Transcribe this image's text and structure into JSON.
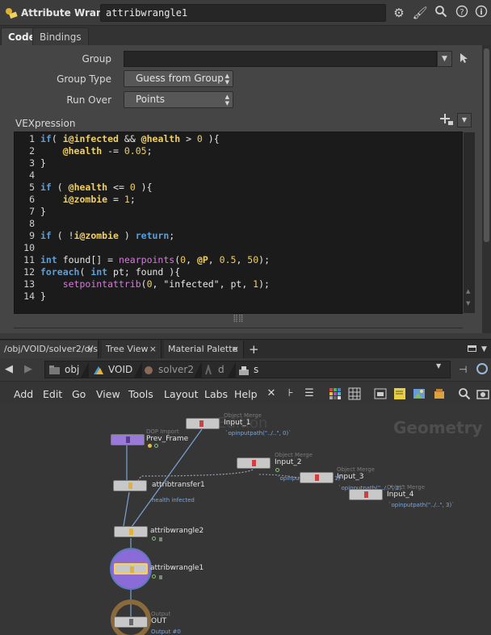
{
  "header": {
    "node_type": "Attribute Wrangle",
    "node_name": "attribwrangle1",
    "icons": [
      "gear-icon",
      "paint-brush-icon",
      "search-icon",
      "help-icon",
      "info-icon"
    ]
  },
  "tabs": [
    {
      "label": "Code",
      "active": true
    },
    {
      "label": "Bindings",
      "active": false
    }
  ],
  "params": {
    "group_label": "Group",
    "group_value": "",
    "group_type_label": "Group Type",
    "group_type_value": "Guess from Group",
    "run_over_label": "Run Over",
    "run_over_value": "Points",
    "vexpression_label": "VEXpression"
  },
  "code": {
    "line_numbers": [
      "1",
      "2",
      "3",
      "4",
      "5",
      "6",
      "7",
      "8",
      "9",
      "10",
      "11",
      "12",
      "13",
      "14"
    ],
    "lines": [
      "if( i@infected && @health > 0 ){",
      "    @health -= 0.05;",
      "}",
      "",
      "if ( @health <= 0 ){",
      "    i@zombie = 1;",
      "}",
      "",
      "if ( !i@zombie ) return;",
      "",
      "int found[] = nearpoints(0, @P, 0.5, 50);",
      "foreach( int pt; found ){",
      "    setpointattrib(0, \"infected\", pt, 1);",
      "}"
    ]
  },
  "network_tabs": [
    {
      "label": "/obj/VOID/solver2/d/s",
      "closable": true,
      "active": true
    },
    {
      "label": "Tree View",
      "closable": true,
      "active": false
    },
    {
      "label": "Material Palette",
      "closable": true,
      "active": false
    }
  ],
  "path": [
    "obj",
    "VOID",
    "solver2",
    "d",
    "s"
  ],
  "menu": [
    "Add",
    "Edit",
    "Go",
    "View",
    "Tools",
    "Layout",
    "Labs",
    "Help"
  ],
  "network": {
    "watermark": "n Edition",
    "context": "Geometry",
    "nodes": [
      {
        "id": "input1",
        "type": "Object Merge",
        "name": "Input_1",
        "sub": "`opinputpath(\"../..\", 0)`"
      },
      {
        "id": "prev",
        "type": "DOP Import",
        "name": "Prev_Frame",
        "sub": ""
      },
      {
        "id": "input2",
        "type": "Object Merge",
        "name": "Input_2",
        "sub": "`opinputpath(\"../..\", 1)`"
      },
      {
        "id": "input3",
        "type": "Object Merge",
        "name": "Input_3",
        "sub": "`opinputpath(\"../..\", 2)`"
      },
      {
        "id": "input4",
        "type": "Object Merge",
        "name": "Input_4",
        "sub": "`opinputpath(\"../..\", 3)`"
      },
      {
        "id": "transfer",
        "type": "",
        "name": "attribtransfer1",
        "sub": "health infected"
      },
      {
        "id": "wrangle2",
        "type": "",
        "name": "attribwrangle2",
        "sub": ""
      },
      {
        "id": "wrangle1",
        "type": "",
        "name": "attribwrangle1",
        "sub": ""
      },
      {
        "id": "out",
        "type": "Output",
        "name": "OUT",
        "sub": "Output #0"
      }
    ]
  }
}
